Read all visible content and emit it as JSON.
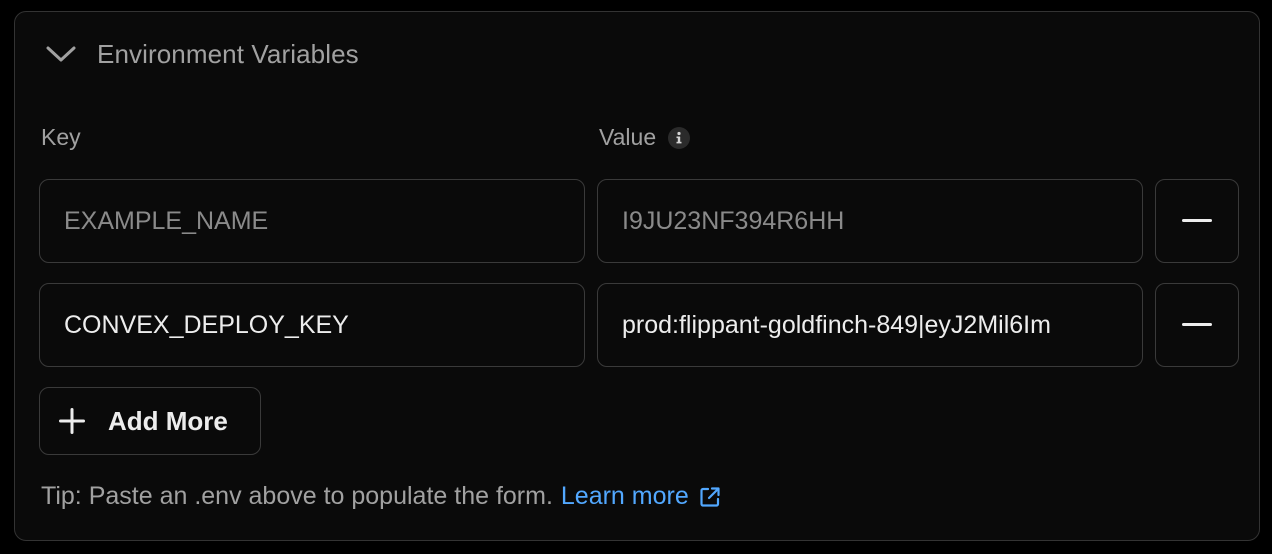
{
  "section": {
    "title": "Environment Variables",
    "expanded": true
  },
  "columns": {
    "key_label": "Key",
    "value_label": "Value"
  },
  "rows": [
    {
      "key": "",
      "key_placeholder": "EXAMPLE_NAME",
      "value": "",
      "value_placeholder": "I9JU23NF394R6HH"
    },
    {
      "key": "CONVEX_DEPLOY_KEY",
      "key_placeholder": "EXAMPLE_NAME",
      "value": "prod:flippant-goldfinch-849|eyJ2Mil6Im",
      "value_placeholder": "I9JU23NF394R6HH"
    }
  ],
  "actions": {
    "add_more_label": "Add More"
  },
  "tip": {
    "text": "Tip: Paste an .env above to populate the form.",
    "link_label": "Learn more"
  },
  "colors": {
    "background": "#0a0a0a",
    "border": "#333333",
    "text_muted": "#a1a1a1",
    "text_primary": "#ededed",
    "link": "#52a8ff"
  },
  "icons": {
    "collapse": "chevron-down-icon",
    "info": "info-icon",
    "remove": "minus-icon",
    "add": "plus-icon",
    "external": "external-link-icon"
  }
}
